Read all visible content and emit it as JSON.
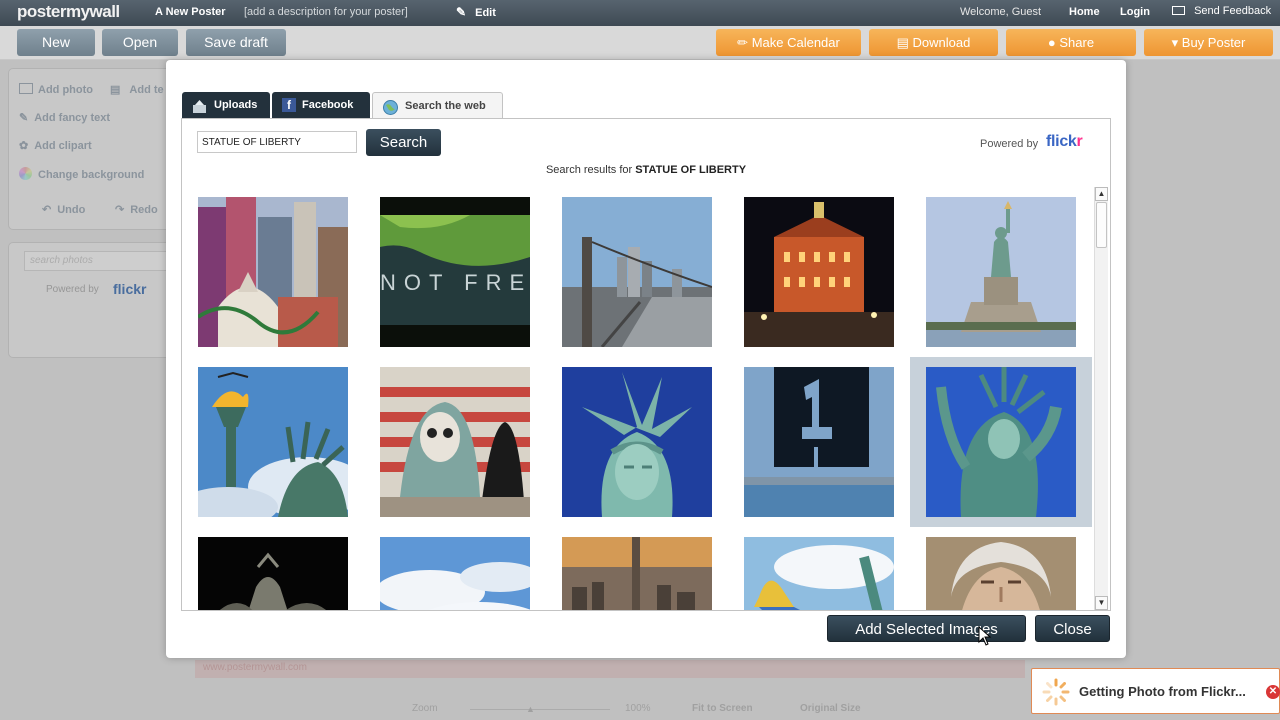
{
  "app": {
    "logo": "postermywall",
    "poster_title": "A New Poster",
    "poster_description": "[add a description for your poster]",
    "edit_label": "Edit",
    "welcome": "Welcome, Guest",
    "home": "Home",
    "login": "Login",
    "feedback": "Send Feedback"
  },
  "toolbar": {
    "new": "New",
    "open": "Open",
    "save_draft": "Save draft",
    "make_calendar": "Make Calendar",
    "download": "Download",
    "share": "Share",
    "buy_poster": "Buy Poster"
  },
  "left_panel": {
    "add_photo": "Add photo",
    "add_text": "Add te",
    "add_fancy_text": "Add fancy text",
    "add_clipart": "Add clipart",
    "change_background": "Change background",
    "undo": "Undo",
    "redo": "Redo",
    "search_placeholder": "search photos",
    "powered_by": "Powered by",
    "flickr": "flickr"
  },
  "dialog": {
    "tabs": [
      "Uploads",
      "Facebook",
      "Search the web"
    ],
    "active_tab": "Search the web",
    "search_value": "STATUE OF LIBERTY",
    "search_button": "Search",
    "powered_by": "Powered by",
    "flickr_main": "flick",
    "flickr_r": "r",
    "results_prefix": "Search results for",
    "results_query": "STATUE OF LIBERTY",
    "selected_index": 9,
    "add_selected": "Add Selected Images",
    "close": "Close"
  },
  "notification": {
    "text": "Getting Photo from Flickr..."
  },
  "bottom_bar": {
    "zoom": "Zoom",
    "zoom_value": "100%",
    "fit_to_screen": "Fit to Screen",
    "original_size": "Original Size"
  },
  "colors": {
    "accent_dark": "#23313c",
    "orange": "#ee9532",
    "selection": "#c7d1da"
  }
}
